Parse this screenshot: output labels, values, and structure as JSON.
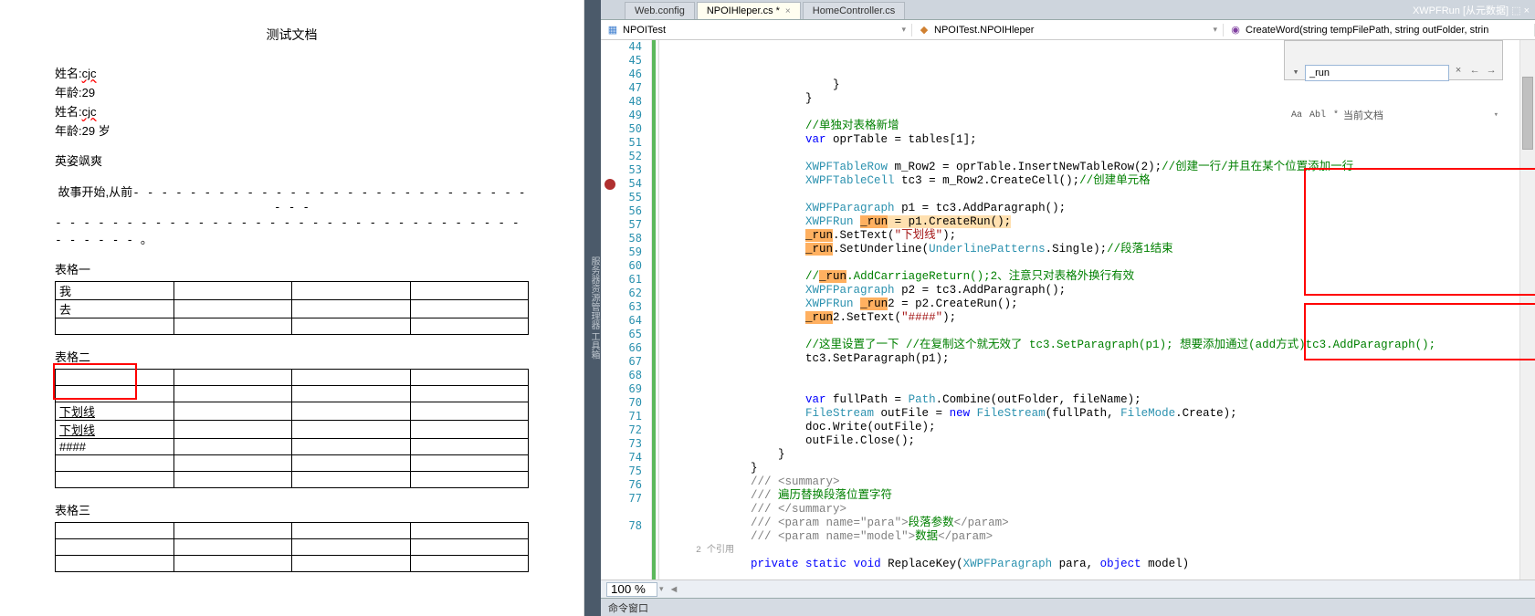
{
  "doc": {
    "title": "测试文档",
    "lines": [
      {
        "label": "姓名:",
        "val": "cjc",
        "wavy": true
      },
      {
        "label": "年龄:",
        "val": "29"
      },
      {
        "label": "姓名:",
        "val": "cjc",
        "wavy": true
      },
      {
        "label": "年龄:",
        "val": "29 岁"
      }
    ],
    "idiom": "英姿飒爽",
    "story_prefix": "故事开始,从前",
    "story_dash1": "- - - - - - - - - - - - - - - - - - - - - - - - - - - - - - -",
    "story_dash2": "- - - - - - - - - - - - - - - - - - - - - - - - - - - - - - - - - - - - - - - 。",
    "table1_label": "表格一",
    "table1": [
      [
        "我",
        "",
        "",
        ""
      ],
      [
        "去",
        "",
        "",
        ""
      ],
      [
        "",
        "",
        "",
        ""
      ]
    ],
    "table2_label": "表格二",
    "table2": [
      [
        "",
        "",
        "",
        ""
      ],
      [
        "",
        "",
        "",
        ""
      ],
      [
        "下划线",
        "",
        "",
        ""
      ],
      [
        "下划线",
        "",
        "",
        ""
      ],
      [
        "####",
        "",
        "",
        ""
      ],
      [
        "",
        "",
        "",
        ""
      ],
      [
        "",
        "",
        "",
        ""
      ]
    ],
    "table3_label": "表格三",
    "table3": [
      [
        "",
        "",
        "",
        ""
      ],
      [
        "",
        "",
        "",
        ""
      ],
      [
        "",
        "",
        "",
        ""
      ]
    ]
  },
  "ide": {
    "vbar_label": "服务器资源管理器 工具箱",
    "title_right": "XWPFRun [从元数据] ⬚ ×",
    "tabs": [
      {
        "name": "Web.config",
        "active": false
      },
      {
        "name": "NPOIHleper.cs",
        "active": true,
        "dirty": "*"
      },
      {
        "name": "HomeController.cs",
        "active": false
      }
    ],
    "crumbs": {
      "proj": "NPOITest",
      "ns": "NPOITest.NPOIHleper",
      "method": "CreateWord(string tempFilePath, string outFolder, strin"
    },
    "find": {
      "value": "_run",
      "close": "×",
      "arrow_l": "←",
      "arrow_r": "→",
      "chev": "▾",
      "opts": [
        "Aa",
        "Abl",
        "*"
      ],
      "scope": "当前文档"
    },
    "zoom": "100 %",
    "bottom_panel": "命令窗口",
    "line_start": 44,
    "code": [
      {
        "n": 44,
        "t": [
          "                    }"
        ]
      },
      {
        "n": 45,
        "t": [
          "                }"
        ]
      },
      {
        "n": 46,
        "t": []
      },
      {
        "n": 47,
        "t": [
          "                ",
          {
            "c": "cmt",
            "v": "//单独对表格新增"
          }
        ]
      },
      {
        "n": 48,
        "t": [
          "                ",
          {
            "c": "kw",
            "v": "var"
          },
          " oprTable = tables[1];"
        ]
      },
      {
        "n": 49,
        "t": []
      },
      {
        "n": 50,
        "t": [
          "                ",
          {
            "c": "typ",
            "v": "XWPFTableRow"
          },
          " m_Row2 = oprTable.InsertNewTableRow(2);",
          {
            "c": "cmt",
            "v": "//创建一行/并且在某个位置添加一行"
          }
        ]
      },
      {
        "n": 51,
        "t": [
          "                ",
          {
            "c": "typ",
            "v": "XWPFTableCell"
          },
          " tc3 = m_Row2.CreateCell();",
          {
            "c": "cmt",
            "v": "//创建单元格"
          }
        ]
      },
      {
        "n": 52,
        "t": []
      },
      {
        "n": 53,
        "t": [
          "                ",
          {
            "c": "typ",
            "v": "XWPFParagraph"
          },
          " p1 = tc3.AddParagraph();"
        ]
      },
      {
        "n": 54,
        "bp": true,
        "t": [
          "                ",
          {
            "c": "hl-line",
            "v": ""
          },
          {
            "c": "typ",
            "v": "XWPFRun"
          },
          " ",
          {
            "c": "hl-search",
            "v": "_run"
          },
          {
            "c": "hl-line",
            "v": " = p1.CreateRun();"
          }
        ]
      },
      {
        "n": 55,
        "t": [
          "                ",
          {
            "c": "hl-search",
            "v": "_run"
          },
          ".SetText(",
          {
            "c": "str",
            "v": "\"下划线\""
          },
          ");"
        ]
      },
      {
        "n": 56,
        "t": [
          "                ",
          {
            "c": "hl-search",
            "v": "_run"
          },
          ".SetUnderline(",
          {
            "c": "typ",
            "v": "UnderlinePatterns"
          },
          ".Single);",
          {
            "c": "cmt",
            "v": "//段落1结束"
          }
        ]
      },
      {
        "n": 57,
        "t": []
      },
      {
        "n": 58,
        "t": [
          "                ",
          {
            "c": "cmt",
            "v": "//"
          },
          {
            "c": "hl-search",
            "v": "_run"
          },
          {
            "c": "cmt",
            "v": ".AddCarriageReturn();2、注意只对表格外换行有效"
          }
        ]
      },
      {
        "n": 59,
        "t": [
          "                ",
          {
            "c": "typ",
            "v": "XWPFParagraph"
          },
          " p2 = tc3.AddParagraph();"
        ]
      },
      {
        "n": 60,
        "t": [
          "                ",
          {
            "c": "typ",
            "v": "XWPFRun"
          },
          " ",
          {
            "c": "hl-search",
            "v": "_run"
          },
          "2 = p2.CreateRun();"
        ]
      },
      {
        "n": 61,
        "t": [
          "                ",
          {
            "c": "hl-search",
            "v": "_run"
          },
          "2.SetText(",
          {
            "c": "str",
            "v": "\"####\""
          },
          ");"
        ]
      },
      {
        "n": 62,
        "t": []
      },
      {
        "n": 63,
        "t": [
          "                ",
          {
            "c": "cmt",
            "v": "//这里设置了一下 //在复制这个就无效了 tc3.SetParagraph(p1); 想要添加通过(add方式)tc3.AddParagraph();"
          }
        ]
      },
      {
        "n": 64,
        "t": [
          "                tc3.SetParagraph(p1);"
        ]
      },
      {
        "n": 65,
        "t": []
      },
      {
        "n": 66,
        "t": []
      },
      {
        "n": 67,
        "t": [
          "                ",
          {
            "c": "kw",
            "v": "var"
          },
          " fullPath = ",
          {
            "c": "typ",
            "v": "Path"
          },
          ".Combine(outFolder, fileName);"
        ]
      },
      {
        "n": 68,
        "t": [
          "                ",
          {
            "c": "typ",
            "v": "FileStream"
          },
          " outFile = ",
          {
            "c": "kw",
            "v": "new"
          },
          " ",
          {
            "c": "typ",
            "v": "FileStream"
          },
          "(fullPath, ",
          {
            "c": "typ",
            "v": "FileMode"
          },
          ".Create);"
        ]
      },
      {
        "n": 69,
        "t": [
          "                doc.Write(outFile);"
        ]
      },
      {
        "n": 70,
        "t": [
          "                outFile.Close();"
        ]
      },
      {
        "n": 71,
        "t": [
          "            }"
        ]
      },
      {
        "n": 72,
        "t": [
          "        }"
        ]
      },
      {
        "n": 73,
        "t": [
          "        ",
          {
            "c": "xml-tag",
            "v": "/// <summary>"
          }
        ]
      },
      {
        "n": 74,
        "t": [
          "        ",
          {
            "c": "xml-tag",
            "v": "/// "
          },
          {
            "c": "cmt",
            "v": "遍历替换段落位置字符"
          }
        ]
      },
      {
        "n": 75,
        "t": [
          "        ",
          {
            "c": "xml-tag",
            "v": "/// </summary>"
          }
        ]
      },
      {
        "n": 76,
        "t": [
          "        ",
          {
            "c": "xml-tag",
            "v": "/// <param name=\""
          },
          {
            "c": "xml-attr",
            "v": "para"
          },
          {
            "c": "xml-tag",
            "v": "\">"
          },
          {
            "c": "cmt",
            "v": "段落参数"
          },
          {
            "c": "xml-tag",
            "v": "</param>"
          }
        ]
      },
      {
        "n": 77,
        "t": [
          "        ",
          {
            "c": "xml-tag",
            "v": "/// <param name=\""
          },
          {
            "c": "xml-attr",
            "v": "model"
          },
          {
            "c": "xml-tag",
            "v": "\">"
          },
          {
            "c": "cmt",
            "v": "数据"
          },
          {
            "c": "xml-tag",
            "v": "</param>"
          }
        ]
      },
      {
        "codelens": "2 个引用"
      },
      {
        "n": 78,
        "t": [
          "        ",
          {
            "c": "kw",
            "v": "private"
          },
          " ",
          {
            "c": "kw",
            "v": "static"
          },
          " ",
          {
            "c": "kw",
            "v": "void"
          },
          " ReplaceKey(",
          {
            "c": "typ",
            "v": "XWPFParagraph"
          },
          " para, ",
          {
            "c": "kw",
            "v": "object"
          },
          " model)"
        ]
      }
    ]
  }
}
